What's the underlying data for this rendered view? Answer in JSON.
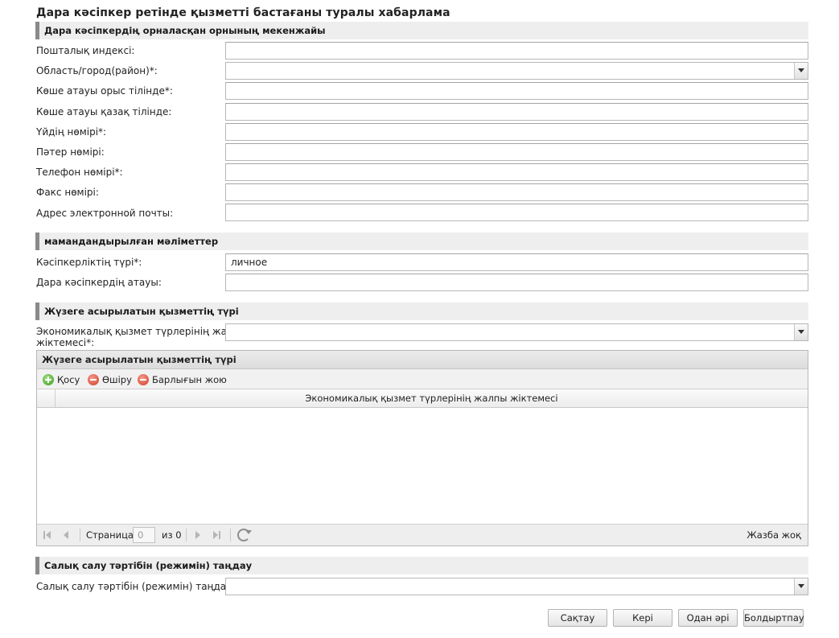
{
  "page_title": "Дара кәсіпкер ретінде қызметті бастағаны туралы хабарлама",
  "sections": {
    "address": "Дара кәсіпкердің орналасқан орнының мекенжайы",
    "qualified": "мамандандырылған мәліметтер",
    "activity": "Жүзеге асырылатын қызметтің түрі",
    "tax": "Салық салу тәртібін (режимін) таңдау"
  },
  "address_fields": {
    "postal_index": {
      "label": "Пошталық индексі:",
      "value": ""
    },
    "region": {
      "label": "Область/город(район)*:",
      "value": ""
    },
    "street_ru": {
      "label": "Көше атауы орыс тілінде*:",
      "value": ""
    },
    "street_kz": {
      "label": "Көше атауы қазақ тілінде:",
      "value": ""
    },
    "house": {
      "label": "Үйдің нөмірі*:",
      "value": ""
    },
    "apartment": {
      "label": "Пәтер нөмірі:",
      "value": ""
    },
    "phone": {
      "label": "Телефон нөмірі*:",
      "value": ""
    },
    "fax": {
      "label": "Факс нөмірі:",
      "value": ""
    },
    "email": {
      "label": "Адрес электронной почты:",
      "value": ""
    }
  },
  "qualified_fields": {
    "business_type": {
      "label": "Кәсіпкерліктің түрі*:",
      "value": "личное"
    },
    "entrepreneur_name": {
      "label": "Дара кәсіпкердің атауы:",
      "value": ""
    }
  },
  "activity_fields": {
    "classifier": {
      "label_line1": "Экономикалық қызмет түрлерінің жалпы",
      "label_line2": "жіктемесі*:",
      "value": ""
    }
  },
  "grid": {
    "title": "Жүзеге асырылатын қызметтің түрі",
    "toolbar": {
      "add": "Қосу",
      "delete": "Өшіру",
      "delete_all": "Барлығын жою"
    },
    "column": "Экономикалық қызмет түрлерінің жалпы жіктемесі",
    "pager": {
      "page_label": "Страница",
      "page_value": "0",
      "of_label": "из 0",
      "empty": "Жазба жоқ"
    }
  },
  "tax_fields": {
    "regime": {
      "label": "Салық салу тәртібін (режимін) таңдау*:",
      "value": ""
    }
  },
  "buttons": {
    "save": "Сақтау",
    "back": "Кері",
    "next": "Одан әрі",
    "cancel": "Болдыртпау"
  }
}
